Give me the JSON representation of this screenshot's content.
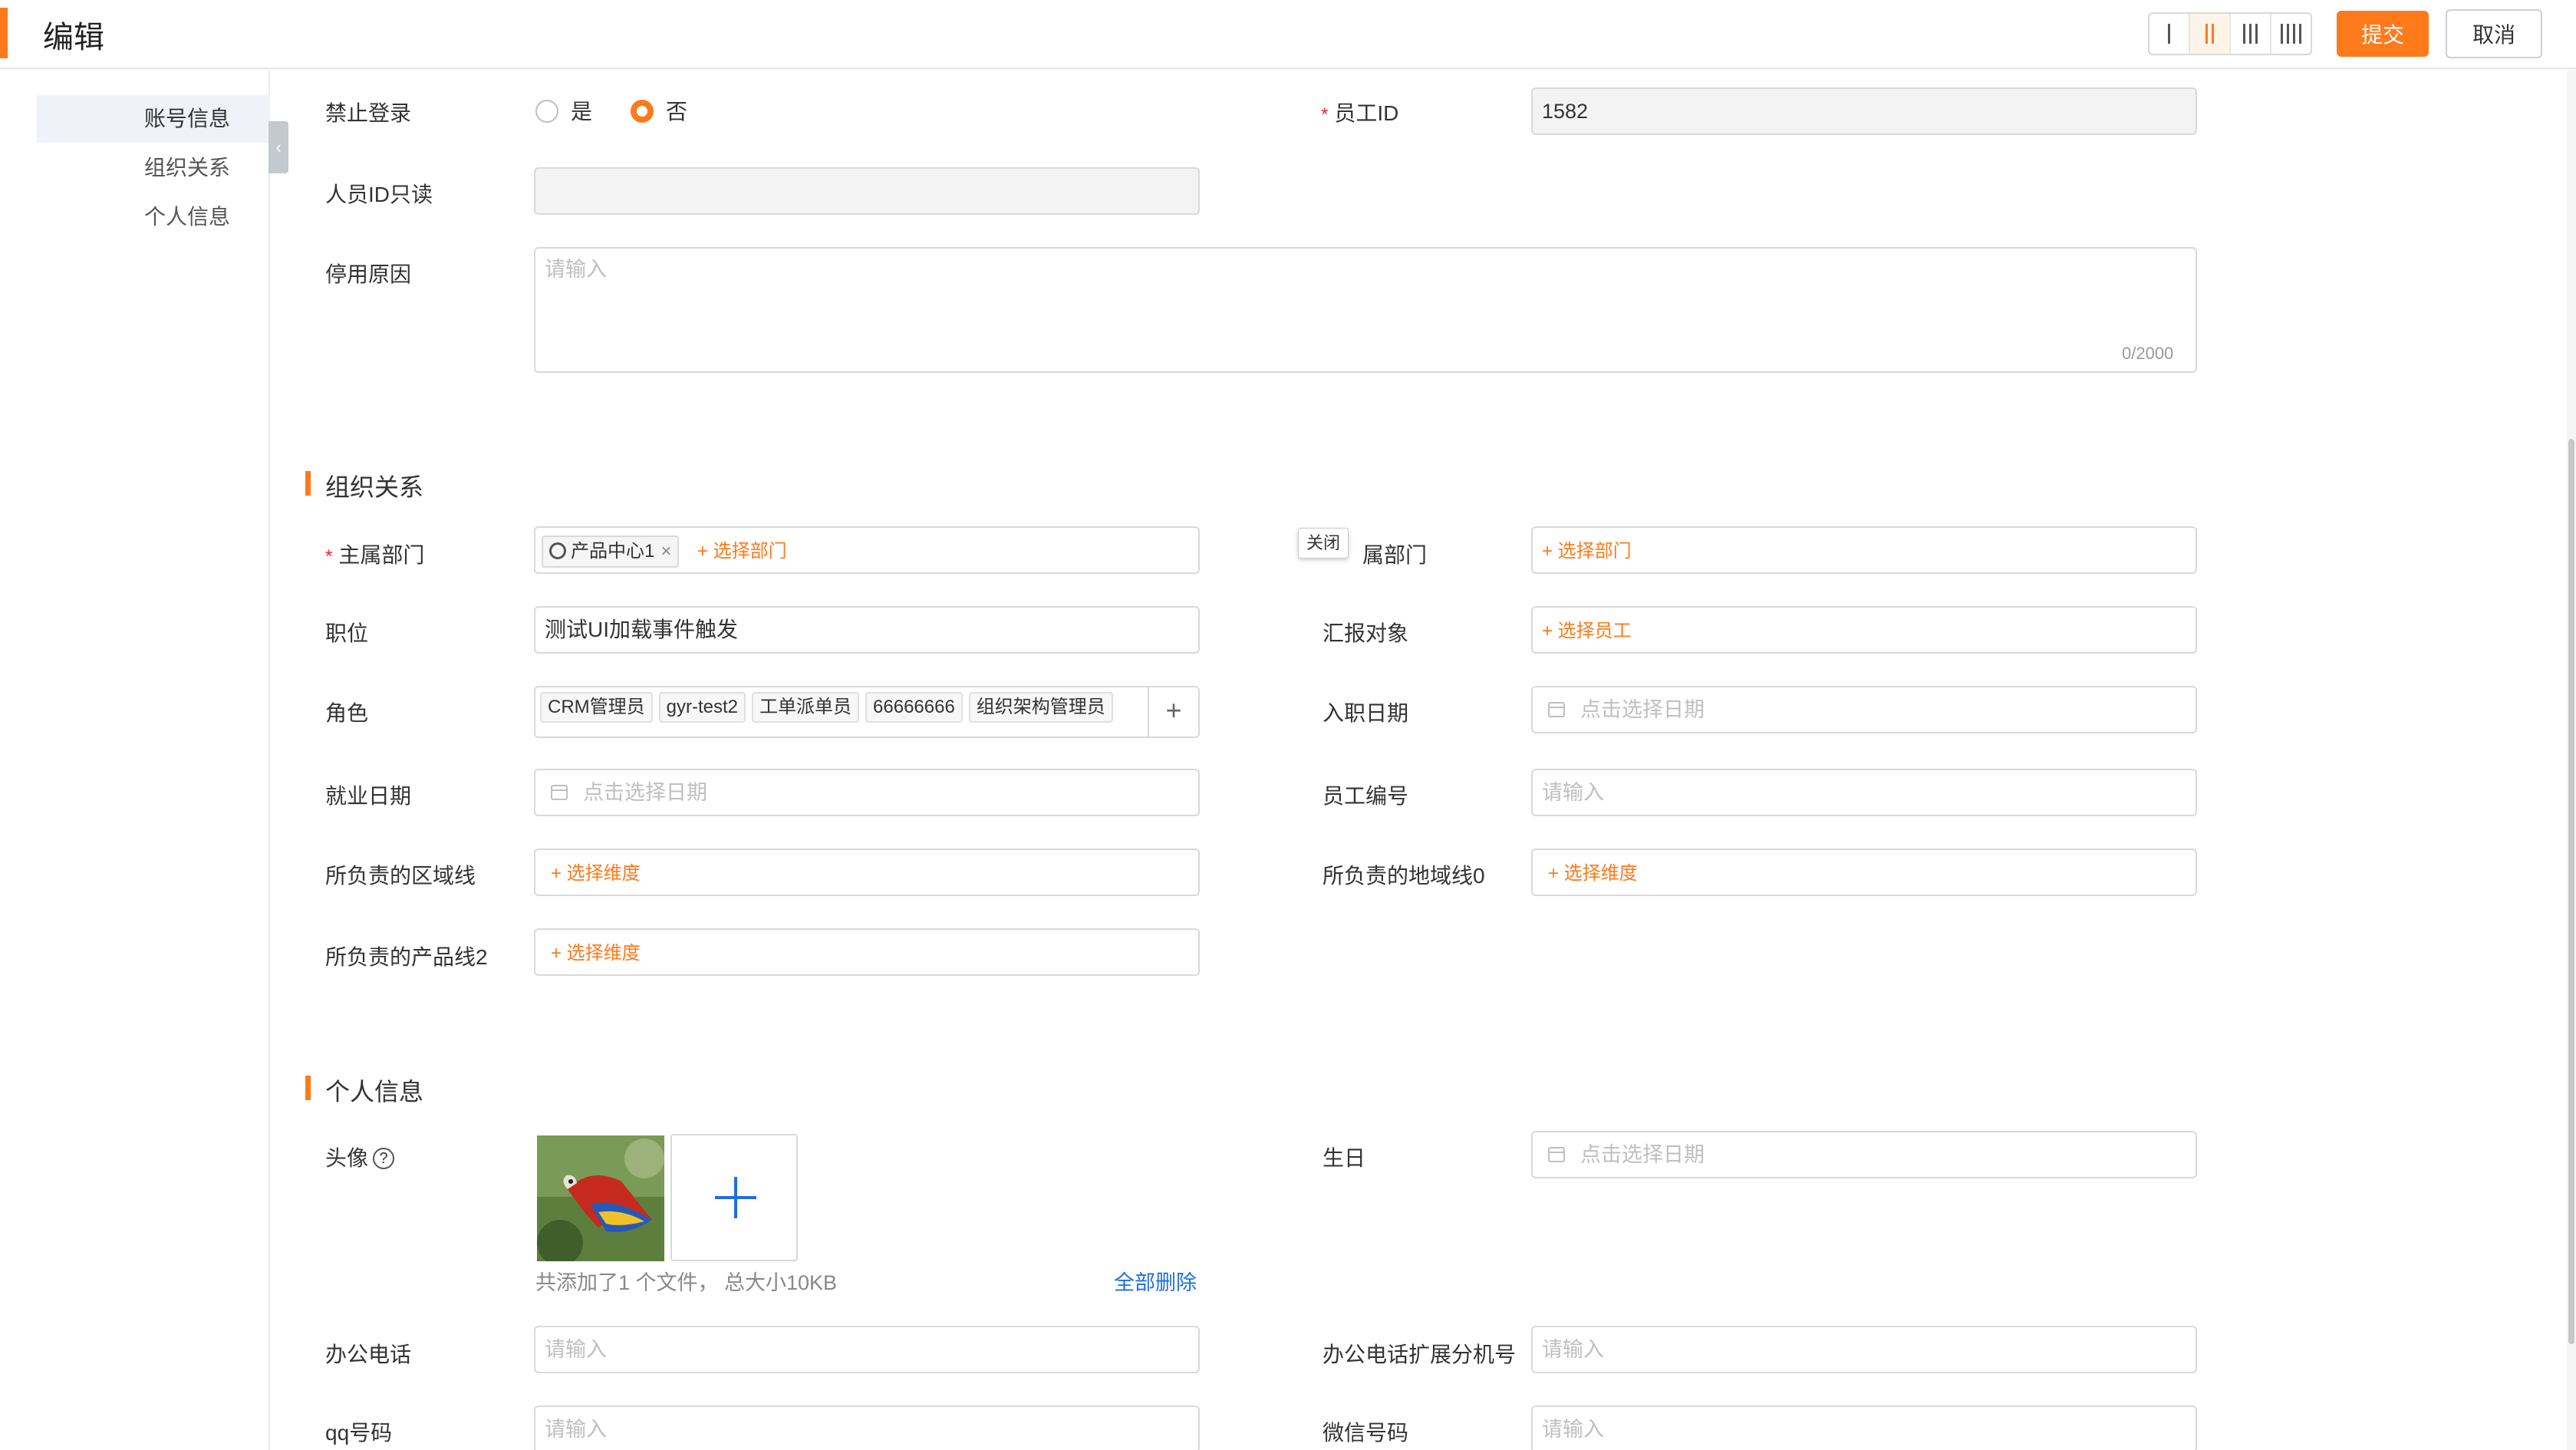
{
  "header": {
    "title": "编辑",
    "submit": "提交",
    "cancel": "取消",
    "layout_options": [
      "single-column-icon",
      "two-column-icon",
      "three-column-icon",
      "four-column-icon"
    ],
    "active_layout": "two-column-icon"
  },
  "sidebar": {
    "items": [
      {
        "label": "账号信息",
        "active": true
      },
      {
        "label": "组织关系",
        "active": false
      },
      {
        "label": "个人信息",
        "active": false
      }
    ],
    "collapse_glyph": "‹"
  },
  "account": {
    "ban_login": {
      "label": "禁止登录",
      "yes": "是",
      "no": "否",
      "selected": "否"
    },
    "employee_id": {
      "label": "员工ID",
      "value": "1582"
    },
    "person_id_readonly": {
      "label": "人员ID只读",
      "value": ""
    },
    "disable_reason": {
      "label": "停用原因",
      "placeholder": "请输入",
      "counter": "0/2000"
    }
  },
  "org": {
    "section_title": "组织关系",
    "main_dept": {
      "label": "主属部门",
      "tag": "产品中心1",
      "tag_close": "×",
      "select": "+ 选择部门"
    },
    "other_dept": {
      "label": "属部门",
      "select": "+ 选择部门"
    },
    "tooltip": "关闭",
    "position": {
      "label": "职位",
      "value": "测试UI加载事件触发"
    },
    "report_to": {
      "label": "汇报对象",
      "select": "+ 选择员工"
    },
    "role": {
      "label": "角色",
      "tags": [
        "CRM管理员",
        "gyr-test2",
        "工单派单员",
        "66666666",
        "组织架构管理员"
      ],
      "add": "+"
    },
    "hire_date": {
      "label": "入职日期",
      "placeholder": "点击选择日期"
    },
    "employment_date": {
      "label": "就业日期",
      "placeholder": "点击选择日期"
    },
    "employee_no": {
      "label": "员工编号",
      "placeholder": "请输入"
    },
    "region_line": {
      "label": "所负责的区域线",
      "select": "+ 选择维度"
    },
    "area_line": {
      "label": "所负责的地域线0",
      "select": "+ 选择维度"
    },
    "product_line": {
      "label": "所负责的产品线2",
      "select": "+ 选择维度"
    }
  },
  "personal": {
    "section_title": "个人信息",
    "avatar": {
      "label": "头像",
      "help": "?",
      "file_info": "共添加了1 个文件，  总大小10KB",
      "delete_all": "全部删除"
    },
    "birthday": {
      "label": "生日",
      "placeholder": "点击选择日期"
    },
    "office_phone": {
      "label": "办公电话",
      "placeholder": "请输入"
    },
    "office_ext": {
      "label": "办公电话扩展分机号",
      "placeholder": "请输入"
    },
    "qq": {
      "label": "qq号码",
      "placeholder": "请输入"
    },
    "wechat": {
      "label": "微信号码",
      "placeholder": "请输入"
    }
  },
  "colors": {
    "accent": "#ff7a1a",
    "link": "#1e6fe0",
    "required": "#f5222d"
  }
}
